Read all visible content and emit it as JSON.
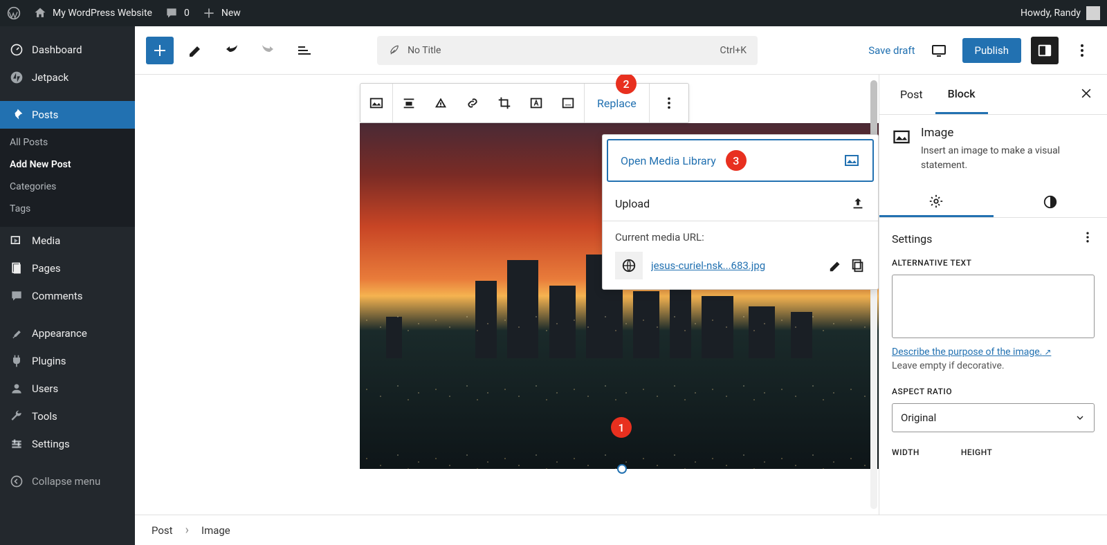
{
  "adminbar": {
    "site_name": "My WordPress Website",
    "comments": "0",
    "new_label": "New",
    "howdy": "Howdy, Randy"
  },
  "sidebar": {
    "items": [
      {
        "label": "Dashboard",
        "icon": "dashboard"
      },
      {
        "label": "Jetpack",
        "icon": "jetpack"
      },
      {
        "label": "Posts",
        "icon": "pin",
        "active": true,
        "submenu": [
          {
            "label": "All Posts"
          },
          {
            "label": "Add New Post",
            "current": true
          },
          {
            "label": "Categories"
          },
          {
            "label": "Tags"
          }
        ]
      },
      {
        "label": "Media",
        "icon": "media"
      },
      {
        "label": "Pages",
        "icon": "page"
      },
      {
        "label": "Comments",
        "icon": "comment"
      },
      {
        "label": "Appearance",
        "icon": "brush"
      },
      {
        "label": "Plugins",
        "icon": "plugin"
      },
      {
        "label": "Users",
        "icon": "user"
      },
      {
        "label": "Tools",
        "icon": "wrench"
      },
      {
        "label": "Settings",
        "icon": "settings"
      },
      {
        "label": "Collapse menu",
        "icon": "collapse"
      }
    ]
  },
  "editor_header": {
    "title_placeholder": "No Title",
    "shortcut": "Ctrl+K",
    "save_draft": "Save draft",
    "publish": "Publish"
  },
  "block_toolbar": {
    "replace": "Replace"
  },
  "badges": {
    "b1": "1",
    "b2": "2",
    "b3": "3"
  },
  "replace_dropdown": {
    "open_media": "Open Media Library",
    "upload": "Upload",
    "current_url_label": "Current media URL:",
    "filename": "jesus-curiel-nsk...683.jpg"
  },
  "right_panel": {
    "tab_post": "Post",
    "tab_block": "Block",
    "block_name": "Image",
    "block_desc": "Insert an image to make a visual statement.",
    "settings_label": "Settings",
    "alt_label": "ALTERNATIVE TEXT",
    "desc_link": "Describe the purpose of the image.",
    "help_text": "Leave empty if decorative.",
    "aspect_label": "ASPECT RATIO",
    "aspect_value": "Original",
    "width_label": "WIDTH",
    "height_label": "HEIGHT"
  },
  "breadcrumb": {
    "level1": "Post",
    "level2": "Image"
  }
}
